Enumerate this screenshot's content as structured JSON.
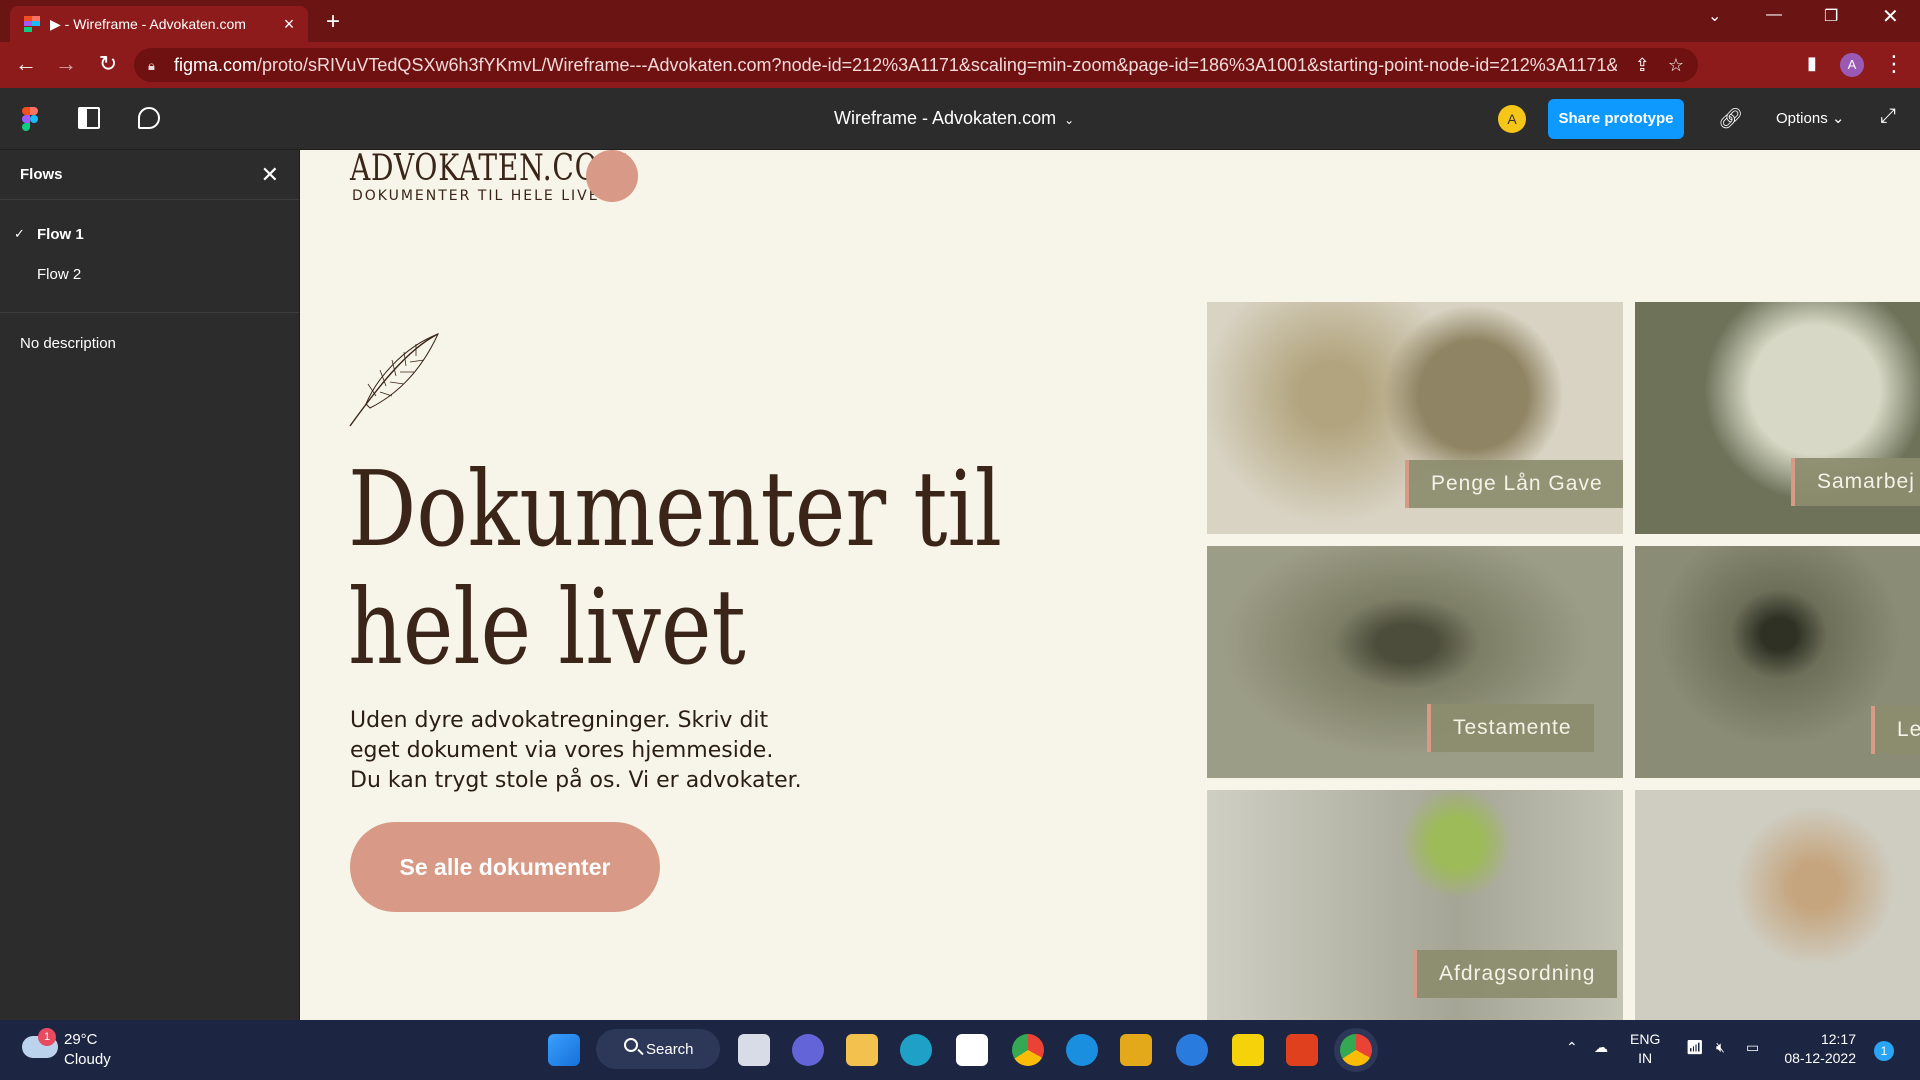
{
  "browser": {
    "tab_title": "▶ - Wireframe - Advokaten.com",
    "url_host": "figma.com",
    "url_rest": "/proto/sRIVuVTedQSXw6h3fYKmvL/Wireframe---Advokaten.com?node-id=212%3A1171&scaling=min-zoom&page-id=186%3A1001&starting-point-node-id=212%3A1171&show-prot...",
    "profile_initial": "A"
  },
  "figma": {
    "doc_title": "Wireframe - Advokaten.com",
    "user_initial": "A",
    "share_label": "Share prototype",
    "options_label": "Options"
  },
  "sidebar": {
    "heading": "Flows",
    "flows": [
      {
        "label": "Flow 1",
        "active": true
      },
      {
        "label": "Flow 2",
        "active": false
      }
    ],
    "description": "No description"
  },
  "page": {
    "brand": "ADVOKATEN.COM",
    "brand_sub": "DOKUMENTER TIL HELE LIVET",
    "hero_line1": "Dokumenter til",
    "hero_line2": "hele livet",
    "lead": "Uden dyre advokatregninger. Skriv dit eget dokument via vores hjemmeside. Du kan trygt stole på os. Vi er advokater.",
    "cta": "Se alle dokumenter",
    "tiles": [
      "Penge Lån Gave",
      "Samarbej",
      "Testamente",
      "Lej",
      "Afdragsordning",
      ""
    ]
  },
  "taskbar": {
    "temp": "29°C",
    "condition": "Cloudy",
    "weather_badge": "1",
    "search": "Search",
    "lang1": "ENG",
    "lang2": "IN",
    "time": "12:17",
    "date": "08-12-2022",
    "notifications": "1"
  }
}
